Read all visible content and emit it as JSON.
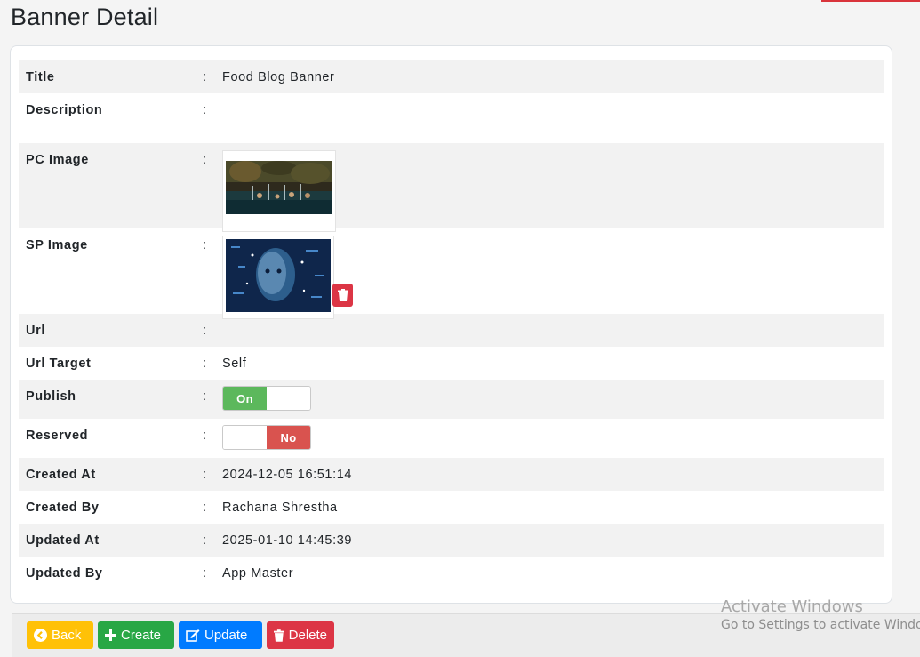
{
  "page": {
    "title": "Banner Detail"
  },
  "details": {
    "separator": ":",
    "title": {
      "label": "Title",
      "value": "Food Blog Banner"
    },
    "description": {
      "label": "Description",
      "value": ""
    },
    "pc_image": {
      "label": "PC Image"
    },
    "sp_image": {
      "label": "SP Image"
    },
    "url": {
      "label": "Url",
      "value": ""
    },
    "url_target": {
      "label": "Url Target",
      "value": "Self"
    },
    "publish": {
      "label": "Publish",
      "state": "On"
    },
    "reserved": {
      "label": "Reserved",
      "state": "No"
    },
    "created_at": {
      "label": "Created At",
      "value": "2024-12-05 16:51:14"
    },
    "created_by": {
      "label": "Created By",
      "value": "Rachana Shrestha"
    },
    "updated_at": {
      "label": "Updated At",
      "value": "2025-01-10 14:45:39"
    },
    "updated_by": {
      "label": "Updated By",
      "value": "App Master"
    }
  },
  "actions": {
    "back": "Back",
    "create": "Create",
    "update": "Update",
    "delete": "Delete"
  },
  "watermark": {
    "line1": "Activate Windows",
    "line2": "Go to Settings to activate Windows."
  },
  "colors": {
    "back": "#ffc107",
    "create": "#28a745",
    "update": "#007bff",
    "delete": "#dc3545",
    "toggle_on": "#5cb85c",
    "toggle_no": "#d9534f"
  }
}
